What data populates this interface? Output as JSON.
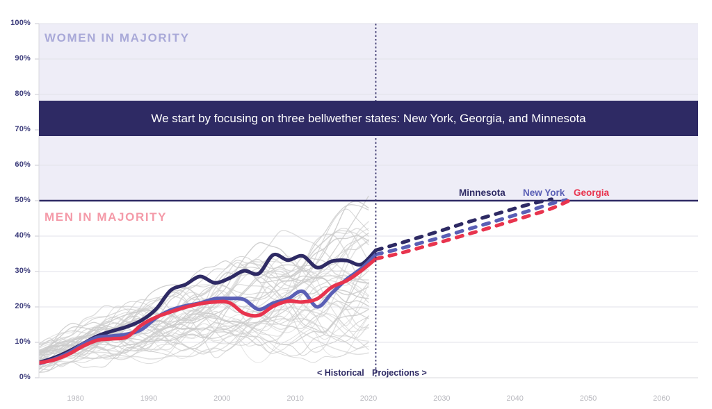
{
  "chart_data": {
    "type": "line",
    "title": "",
    "subtitle": "",
    "xlabel": "",
    "ylabel": "",
    "xlim": [
      1975,
      2065
    ],
    "ylim": [
      0,
      1
    ],
    "grid": true,
    "legend_position": "inside-top-right",
    "y_ticks": [
      "0%",
      "10%",
      "20%",
      "30%",
      "40%",
      "50%",
      "60%",
      "70%",
      "80%",
      "90%",
      "100%"
    ],
    "y_tick_values": [
      0,
      10,
      20,
      30,
      40,
      50,
      60,
      70,
      80,
      90,
      100
    ],
    "x_ticks": [
      "1980",
      "1990",
      "2000",
      "2010",
      "2020",
      "2030",
      "2040",
      "2050",
      "2060"
    ],
    "x_tick_values": [
      1980,
      1990,
      2000,
      2010,
      2020,
      2030,
      2040,
      2050,
      2060
    ],
    "parity_line_value": 50,
    "divider_year": 2021,
    "zones": [
      {
        "name": "women-in-majority",
        "label": "WOMEN IN MAJORITY",
        "range": [
          50,
          100
        ],
        "color": "#a9a9d8",
        "fill": "#eeedf7"
      },
      {
        "name": "men-in-majority",
        "label": "MEN IN MAJORITY",
        "range": [
          0,
          50
        ],
        "color": "#f49aa8",
        "fill": "#ffffff"
      }
    ],
    "annotation": {
      "text": "We start by focusing on three bellwether states: New York, Georgia, and Minnesota",
      "y_range": [
        70,
        80
      ],
      "background": "#2e2a64",
      "text_color": "#ffffff"
    },
    "era_labels": {
      "historical": "< Historical",
      "projections": "Projections >"
    },
    "series": [
      {
        "name": "Minnesota",
        "color": "#2e2a64",
        "x": [
          1975,
          1977,
          1979,
          1981,
          1983,
          1985,
          1987,
          1989,
          1991,
          1993,
          1995,
          1997,
          1999,
          2001,
          2003,
          2005,
          2007,
          2009,
          2011,
          2013,
          2015,
          2017,
          2019,
          2021
        ],
        "values": [
          4.3,
          5.6,
          7.4,
          9.6,
          11.8,
          13.2,
          14.4,
          16.2,
          19.4,
          24.7,
          26.3,
          28.6,
          26.8,
          28.1,
          30.2,
          29.4,
          34.7,
          33.2,
          34.4,
          31.1,
          32.9,
          33.1,
          32.0,
          36.0
        ],
        "projection_x": [
          2021,
          2024,
          2027,
          2030,
          2033,
          2036,
          2039,
          2042,
          2045
        ],
        "projection_values": [
          36.0,
          37.8,
          39.7,
          41.6,
          43.6,
          45.4,
          47.2,
          49.0,
          50.4
        ]
      },
      {
        "name": "New York",
        "color": "#5a5fb5",
        "x": [
          1975,
          1977,
          1979,
          1981,
          1983,
          1985,
          1987,
          1989,
          1991,
          1993,
          1995,
          1997,
          1999,
          2001,
          2003,
          2005,
          2007,
          2009,
          2011,
          2013,
          2015,
          2017,
          2019,
          2021
        ],
        "values": [
          4.0,
          5.2,
          7.0,
          9.5,
          11.4,
          11.8,
          12.3,
          13.6,
          16.9,
          19.1,
          20.3,
          21.1,
          22.3,
          22.4,
          22.1,
          19.3,
          21.1,
          22.3,
          24.4,
          20.0,
          23.9,
          27.8,
          30.8,
          34.8
        ],
        "projection_x": [
          2021,
          2024,
          2027,
          2030,
          2033,
          2036,
          2039,
          2042,
          2045,
          2047
        ],
        "projection_values": [
          34.8,
          36.3,
          38.0,
          39.7,
          41.6,
          43.4,
          45.3,
          47.2,
          49.2,
          50.2
        ]
      },
      {
        "name": "Georgia",
        "color": "#e8344e",
        "x": [
          1975,
          1977,
          1979,
          1981,
          1983,
          1985,
          1987,
          1989,
          1991,
          1993,
          1995,
          1997,
          1999,
          2001,
          2003,
          2005,
          2007,
          2009,
          2011,
          2013,
          2015,
          2017,
          2019,
          2021
        ],
        "values": [
          4.2,
          5.0,
          6.6,
          8.9,
          10.6,
          11.0,
          11.5,
          14.9,
          17.1,
          18.6,
          19.9,
          20.9,
          21.4,
          21.2,
          18.2,
          17.6,
          20.2,
          21.6,
          21.4,
          22.3,
          25.6,
          27.4,
          30.2,
          33.6
        ],
        "projection_x": [
          2021,
          2024,
          2027,
          2030,
          2033,
          2036,
          2039,
          2042,
          2045,
          2048
        ],
        "projection_values": [
          33.6,
          35.0,
          36.7,
          38.4,
          40.2,
          42.0,
          43.9,
          45.8,
          47.8,
          50.6
        ]
      }
    ],
    "background_series_note": "Approximately 45 unhighlighted US state trajectories drawn in light gray",
    "background_series_color": "#cccccc"
  },
  "legend": [
    {
      "label": "Minnesota",
      "color": "#2e2a64"
    },
    {
      "label": "New York",
      "color": "#5a5fb5"
    },
    {
      "label": "Georgia",
      "color": "#e8344e"
    }
  ],
  "zone_labels": {
    "women": "WOMEN IN MAJORITY",
    "men": "MEN IN MAJORITY"
  },
  "banner": {
    "text": "We start by focusing on three bellwether states: New York, Georgia, and Minnesota"
  },
  "era": {
    "historical": "< Historical",
    "projections": "Projections >"
  },
  "colors": {
    "navy": "#2e2a64",
    "blue": "#5a5fb5",
    "red": "#e8344e",
    "zone_fill": "#eeedf7",
    "gray_line": "#cccccc",
    "tick_text": "#3b3b7a",
    "xtick_text": "#b9b9bf"
  }
}
